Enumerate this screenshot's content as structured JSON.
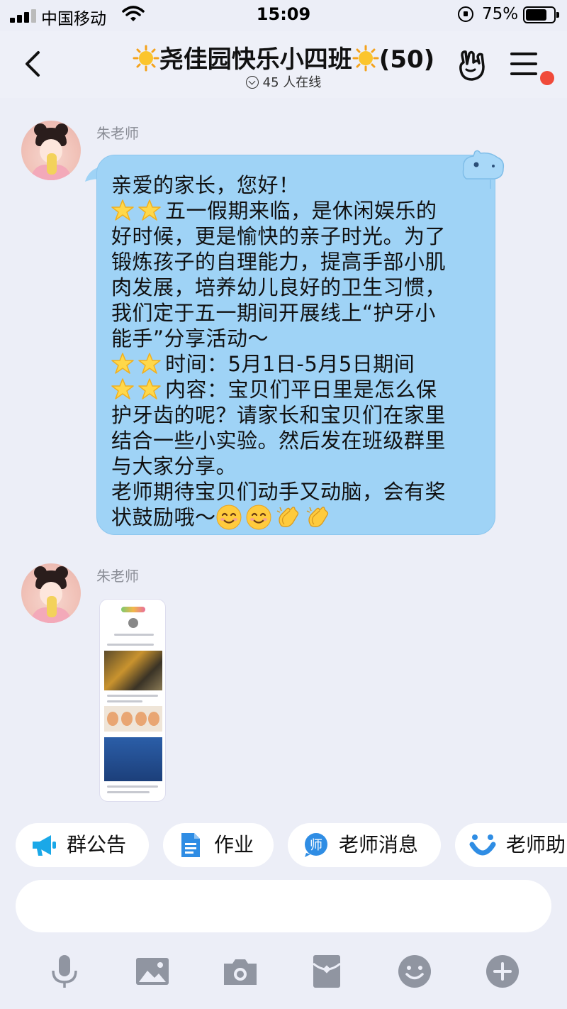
{
  "status": {
    "carrier": "中国移动",
    "time": "15:09",
    "battery_pct": "75%",
    "battery_level": 0.75
  },
  "nav": {
    "title": "尧佳园快乐小四班",
    "member_count": "(50)",
    "online": "45 人在线"
  },
  "messages": [
    {
      "sender": "朱老师",
      "lines": [
        {
          "stars": 0,
          "text": "亲爱的家长，您好！"
        },
        {
          "stars": 2,
          "text": "五一假期来临，是休闲娱乐的"
        },
        {
          "stars": 0,
          "text": "好时候，更是愉快的亲子时光。为了"
        },
        {
          "stars": 0,
          "text": "锻炼孩子的自理能力，提高手部小肌"
        },
        {
          "stars": 0,
          "text": "肉发展，培养幼儿良好的卫生习惯，"
        },
        {
          "stars": 0,
          "text": "我们定于五一期间开展线上“护牙小"
        },
        {
          "stars": 0,
          "text": "能手”分享活动～"
        },
        {
          "stars": 2,
          "text": "时间：5月1日-5月5日期间"
        },
        {
          "stars": 2,
          "text": "内容：宝贝们平日里是怎么保"
        },
        {
          "stars": 0,
          "text": "护牙齿的呢？请家长和宝贝们在家里"
        },
        {
          "stars": 0,
          "text": "结合一些小实验。然后发在班级群里"
        },
        {
          "stars": 0,
          "text": "与大家分享。"
        },
        {
          "stars": 0,
          "text": "老师期待宝贝们动手又动脑，会有奖"
        },
        {
          "stars": 0,
          "text": "状鼓励哦～"
        }
      ],
      "trailing_emojis": [
        "smile-emoji",
        "smile-emoji",
        "clap-emoji",
        "clap-emoji"
      ]
    },
    {
      "sender": "朱老师",
      "type": "image"
    }
  ],
  "quick_actions": [
    {
      "label": "群公告",
      "icon": "megaphone-icon"
    },
    {
      "label": "作业",
      "icon": "document-icon"
    },
    {
      "label": "老师消息",
      "icon": "teacher-badge-icon"
    },
    {
      "label": "老师助",
      "icon": "assistant-icon"
    }
  ],
  "input": {
    "value": "",
    "placeholder": ""
  },
  "toolbar": [
    "microphone-icon",
    "image-icon",
    "camera-icon",
    "red-packet-icon",
    "emoji-icon",
    "plus-icon"
  ],
  "colors": {
    "bubble": "#9fd3f6",
    "background": "#eceef7",
    "badge": "#f04a3a",
    "accent_blue": "#2f8de4"
  }
}
